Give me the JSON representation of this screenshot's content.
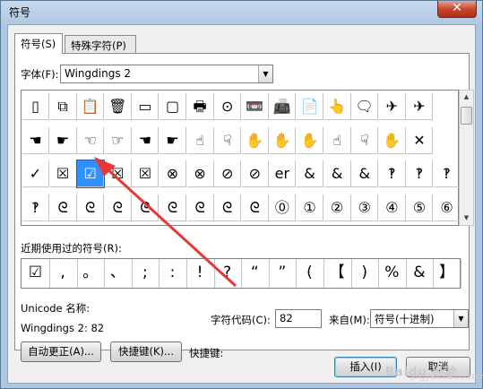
{
  "window": {
    "title": "符号",
    "close_glyph": "✕"
  },
  "tabs": [
    {
      "label": "符号(S)",
      "active": true
    },
    {
      "label": "特殊字符(P)",
      "active": false
    }
  ],
  "font": {
    "label": "字体(F):",
    "value": "Wingdings 2"
  },
  "symbol_grid": {
    "selected_index": 34,
    "rows": [
      [
        "▯",
        "⧉",
        "📋",
        "🗑",
        "▭",
        "▢",
        "🖶",
        "⊙",
        "📼",
        "📠",
        "📄",
        "👆",
        "🗨",
        "✈",
        "✈"
      ],
      [
        "☚",
        "☛",
        "☜",
        "☞",
        "☚",
        "☛",
        "☝",
        "☟",
        "✋",
        "✋",
        "✋",
        "☝",
        "☟",
        "✋",
        "✕"
      ],
      [
        "✓",
        "☒",
        "☑",
        "☒",
        "☒",
        "⊗",
        "⊗",
        "⊘",
        "⊘",
        "er",
        "&",
        "&",
        "&",
        "‽",
        "‽",
        "‽"
      ],
      [
        "‽",
        "ᘓ",
        "ᘓ",
        "ᘓ",
        "ᘓ",
        "ᘓ",
        "ᘓ",
        "ᘓ",
        "ᘓ",
        "⓪",
        "①",
        "②",
        "③",
        "④",
        "⑤",
        "⑥"
      ]
    ]
  },
  "recent": {
    "label": "近期使用过的符号(R):",
    "symbols": [
      "☑",
      ",",
      "。",
      "、",
      ";",
      ":",
      "!",
      "?",
      "“",
      "”",
      "(",
      "【",
      ")",
      "%",
      "&",
      "】"
    ]
  },
  "unicode": {
    "label": "Unicode 名称:",
    "value": "Wingdings 2: 82"
  },
  "char_code": {
    "label": "字符代码(C):",
    "value": "82"
  },
  "from": {
    "label": "来自(M):",
    "value": "符号(十进制)"
  },
  "buttons": {
    "autocorrect": "自动更正(A)...",
    "shortcut_key": "快捷键(K)...",
    "shortcut_label": "快捷键:",
    "insert": "插入(I)",
    "cancel": "取消"
  },
  "watermark": {
    "line1": "Baidu 经验",
    "line2": "jingyan.baidu.com"
  },
  "colors": {
    "selection": "#3390ff",
    "annotation_arrow": "#e53935",
    "titlebar": "#b9d1ea"
  },
  "icons": [
    "dropdown-arrow-icon",
    "scroll-up-icon",
    "scroll-down-icon",
    "close-icon"
  ]
}
